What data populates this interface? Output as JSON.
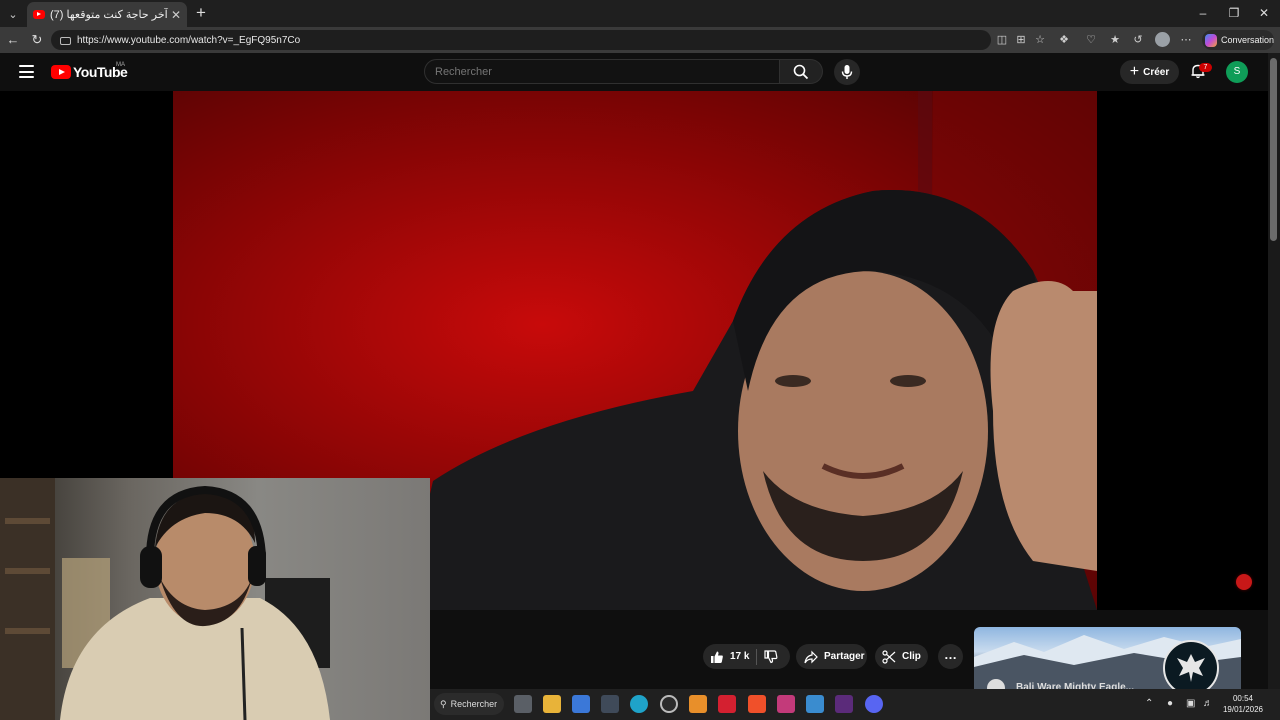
{
  "browser": {
    "tab_title": "(7) آخر حاجة كنت متوقعها - YouTube",
    "new_tab_label": "+",
    "url": "https://www.youtube.com/watch?v=_EgFQ95n7Co",
    "conversation_label": "Conversation",
    "window_controls": [
      "minimize-icon",
      "restore-icon",
      "close-icon"
    ]
  },
  "youtube": {
    "logo_text": "YouTube",
    "region_code": "MA",
    "search_placeholder": "Rechercher",
    "create_label": "Créer",
    "notification_count": "7",
    "avatar_letter": "S",
    "actions": {
      "like_count": "17 k",
      "share_label": "Partager",
      "clip_label": "Clip",
      "more_label": "…"
    },
    "recommendation": {
      "title": "Bali Ware Mighty Eagle..."
    }
  },
  "taskbar": {
    "search_label": "Rechercher",
    "time": "00:54",
    "date": "19/01/2026",
    "apps": [
      "task-view-icon",
      "file-explorer-icon",
      "store-icon",
      "calculator-icon",
      "edge-icon",
      "obs-icon",
      "app-a-icon",
      "wps-icon",
      "brave-icon",
      "brave-alt-icon",
      "window-icon",
      "next-icon",
      "discord-icon"
    ]
  },
  "colors": {
    "youtube_red": "#ff0000",
    "background": "#0f0f0f",
    "pill": "#272727",
    "notification_badge": "#cc0000",
    "avatar": "#0f9d58"
  }
}
